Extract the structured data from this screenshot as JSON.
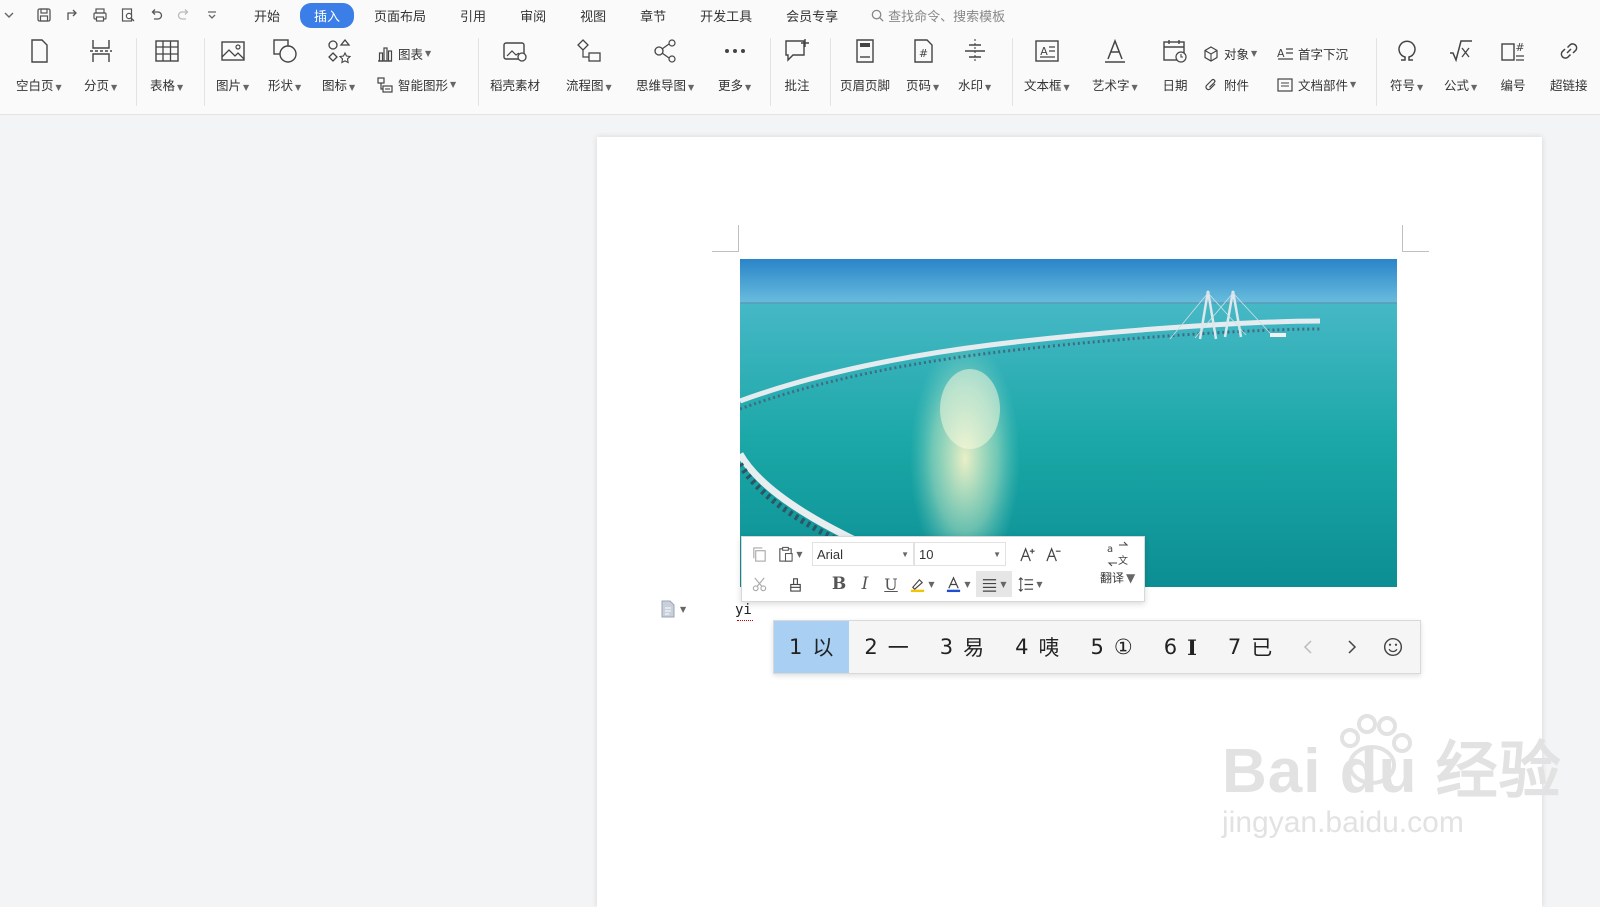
{
  "menubar": {
    "tabs": [
      {
        "label": "开始",
        "active": false
      },
      {
        "label": "插入",
        "active": true
      },
      {
        "label": "页面布局",
        "active": false
      },
      {
        "label": "引用",
        "active": false
      },
      {
        "label": "审阅",
        "active": false
      },
      {
        "label": "视图",
        "active": false
      },
      {
        "label": "章节",
        "active": false
      },
      {
        "label": "开发工具",
        "active": false
      },
      {
        "label": "会员专享",
        "active": false
      }
    ],
    "search_label": "查找命令、搜索模板",
    "accent_color": "#3b7ee8"
  },
  "ribbon": {
    "blank_page": "空白页",
    "page_break": "分页",
    "table": "表格",
    "picture": "图片",
    "shape": "形状",
    "icon": "图标",
    "chart": "图表",
    "smart_art": "智能图形",
    "docer_material": "稻壳素材",
    "flowchart": "流程图",
    "mind_map": "思维导图",
    "more": "更多",
    "comment": "批注",
    "header_footer": "页眉页脚",
    "page_number": "页码",
    "watermark": "水印",
    "text_box": "文本框",
    "word_art": "艺术字",
    "date": "日期",
    "object": "对象",
    "attachment": "附件",
    "drop_cap": "首字下沉",
    "doc_parts": "文档部件",
    "symbol": "符号",
    "formula": "公式",
    "numbering": "编号",
    "hyperlink": "超链接"
  },
  "mini_toolbar": {
    "font_name": "Arial",
    "font_size": "10",
    "translate": "翻译",
    "font_color": "#1f4fd0",
    "highlight_color": "#f2c500"
  },
  "document": {
    "typed_text": "yi"
  },
  "ime": {
    "candidates": [
      {
        "num": "1",
        "text": "以",
        "selected": true
      },
      {
        "num": "2",
        "text": "一",
        "selected": false
      },
      {
        "num": "3",
        "text": "易",
        "selected": false
      },
      {
        "num": "4",
        "text": "咦",
        "selected": false
      },
      {
        "num": "5",
        "text": "①",
        "selected": false
      },
      {
        "num": "6",
        "text": "Ⅰ",
        "selected": false
      },
      {
        "num": "7",
        "text": "已",
        "selected": false
      }
    ]
  },
  "watermark": {
    "brand": "Bai du 经验",
    "url": "jingyan.baidu.com"
  }
}
